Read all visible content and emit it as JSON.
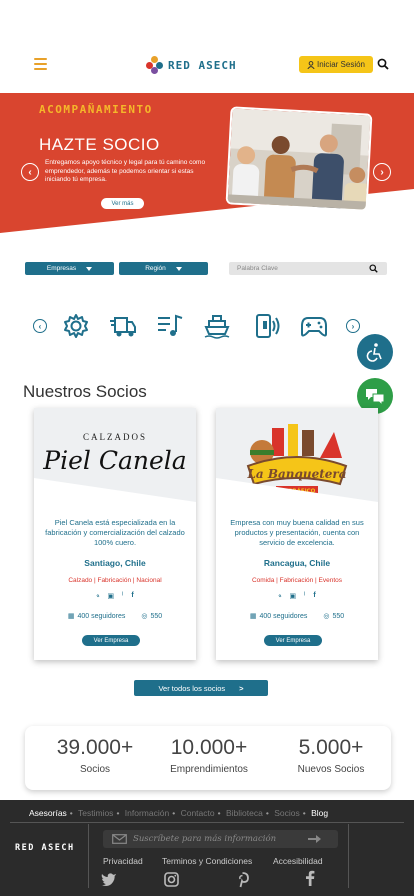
{
  "header": {
    "brand": "RED ASECH",
    "login_label": "Iniciar Sesión",
    "icons": [
      "hamburger-menu-icon",
      "user-icon",
      "search-icon"
    ]
  },
  "hero": {
    "eyebrow": "ACOMPAÑAMIENTO",
    "title": "HAZTE SOCIO",
    "description": "Entregamos apoyo técnico y legal para tú camino como emprendedor, además te podemos orientar si estas iniciando tú empresa.",
    "cta": "Ver más",
    "colors": {
      "red": "#d9452f",
      "gold": "#f5b72a"
    }
  },
  "filters": {
    "empresas": "Empresas",
    "region": "Región",
    "keyword_placeholder": "Palabra Clave"
  },
  "categories": [
    "settings-icon",
    "truck-icon",
    "music-icon",
    "ship-icon",
    "device-icon",
    "gamepad-icon"
  ],
  "section_title": "Nuestros Socios",
  "partners": [
    {
      "logo_top": "CALZADOS",
      "logo_name": "Piel Canela",
      "description": "Piel Canela está especializada en la fabricación y comercialización del calzado 100% cuero.",
      "location": "Santiago, Chile",
      "tags": "Calzado | Fabricación | Nacional",
      "followers": "400 seguidores",
      "views": "550",
      "button": "Ver Empresa"
    },
    {
      "logo_name": "La Banquetera",
      "logo_sub": "EL GRÁFICO",
      "description": "Empresa con muy buena calidad en sus productos y presentación, cuenta con servicio de excelencia.",
      "location": "Rancagua, Chile",
      "tags": "Comida | Fabricación | Eventos",
      "followers": "400 seguidores",
      "views": "550",
      "button": "Ver Empresa"
    }
  ],
  "all_partners_label": "Ver todos los socios",
  "stats": [
    {
      "value": "39.000+",
      "label": "Socios"
    },
    {
      "value": "10.000+",
      "label": "Emprendimientos"
    },
    {
      "value": "5.000+",
      "label": "Nuevos Socios"
    }
  ],
  "footer": {
    "links": [
      "Asesorías",
      "Testimios",
      "Información",
      "Contacto",
      "Biblioteca",
      "Socios",
      "Blog"
    ],
    "brand": "RED ASECH",
    "subscribe_placeholder": "Suscríbete para más información",
    "legal": [
      "Privacidad",
      "Terminos y Condiciones",
      "Accesibilidad"
    ]
  }
}
